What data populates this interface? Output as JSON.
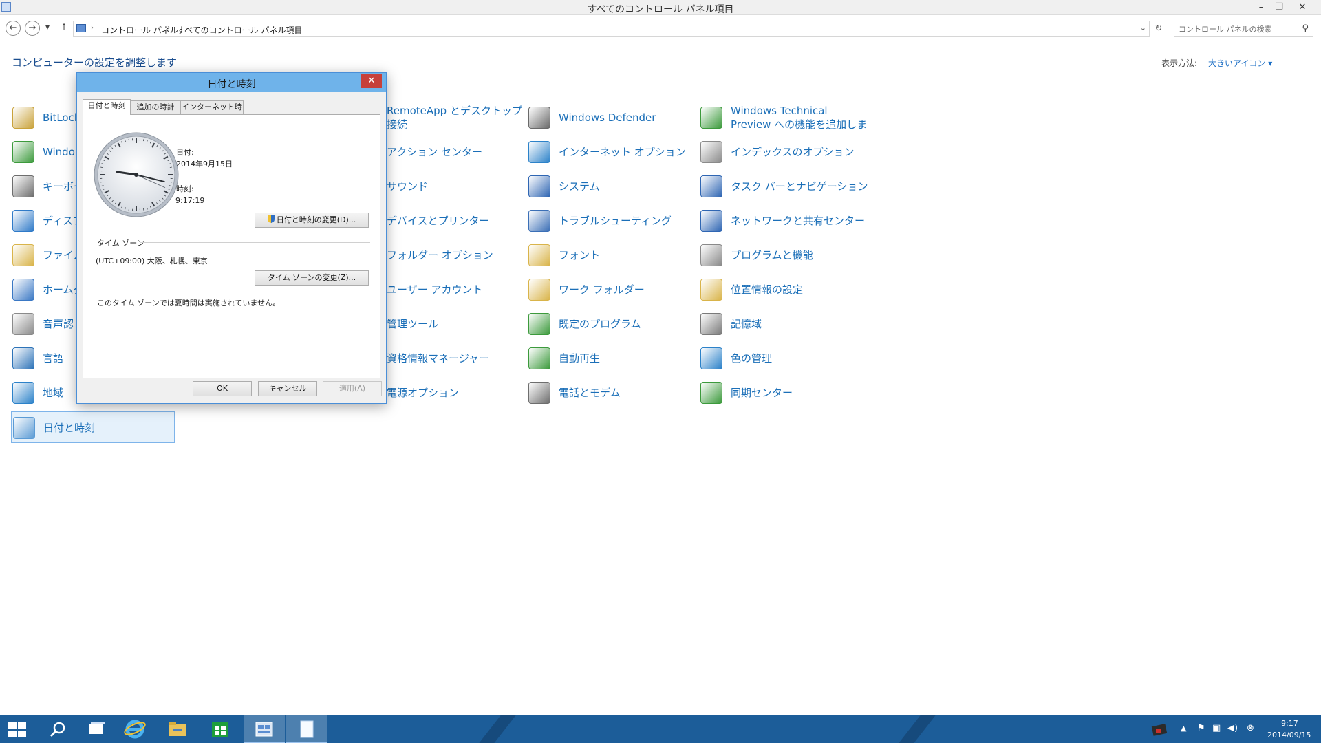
{
  "window": {
    "title": "すべてのコントロール パネル項目",
    "minimize": "–",
    "restore": "❐",
    "close": "✕"
  },
  "addressbar": {
    "back": "←",
    "forward": "→",
    "recent": "▾",
    "up": "↑",
    "breadcrumbs": [
      "コントロール パネル",
      "すべてのコントロール パネル項目"
    ],
    "breadcrumb_sep": "›",
    "dropdown": "⌄",
    "refresh": "↻",
    "search_placeholder": "コントロール パネルの検索",
    "search_glyph": "⚲"
  },
  "header": {
    "heading": "コンピューターの設定を調整します",
    "view_label": "表示方法:",
    "view_value": "大きいアイコン ▾"
  },
  "items": {
    "col1": [
      {
        "label": "BitLock",
        "icon": "bitlocker-icon",
        "color": "#c9a23a"
      },
      {
        "label": "Windo",
        "icon": "windows-update-icon",
        "color": "#3c9a3c"
      },
      {
        "label": "キーボー",
        "icon": "keyboard-icon",
        "color": "#6e6e6e"
      },
      {
        "label": "ディスプ",
        "icon": "display-icon",
        "color": "#2f7ac8"
      },
      {
        "label": "ファイル",
        "icon": "file-history-icon",
        "color": "#d9b44a"
      },
      {
        "label": "ホームグ",
        "icon": "homegroup-icon",
        "color": "#3a78c4"
      },
      {
        "label": "音声認",
        "icon": "microphone-icon",
        "color": "#8a8a8a"
      },
      {
        "label": "言語",
        "icon": "language-icon",
        "color": "#2d73b8"
      },
      {
        "label": "地域",
        "icon": "region-icon",
        "color": "#2c82c9"
      },
      {
        "label": "日付と時刻",
        "icon": "date-time-icon",
        "color": "#5b9bd5"
      }
    ],
    "col2": [
      {
        "label": "RemoteApp とデスクトップ接続",
        "icon": "remoteapp-icon",
        "color": "#3a78c4"
      },
      {
        "label": "アクション センター",
        "icon": "action-center-icon",
        "color": "#3b6fb6"
      },
      {
        "label": "サウンド",
        "icon": "sound-icon",
        "color": "#8c8c8c"
      },
      {
        "label": "デバイスとプリンター",
        "icon": "printer-icon",
        "color": "#6b6b6b"
      },
      {
        "label": "フォルダー オプション",
        "icon": "folder-options-icon",
        "color": "#d9b44a"
      },
      {
        "label": "ユーザー アカウント",
        "icon": "user-accounts-icon",
        "color": "#3c8a4a"
      },
      {
        "label": "管理ツール",
        "icon": "admin-tools-icon",
        "color": "#7a7a7a"
      },
      {
        "label": "資格情報マネージャー",
        "icon": "credential-manager-icon",
        "color": "#c9a23a"
      },
      {
        "label": "電源オプション",
        "icon": "power-options-icon",
        "color": "#3c9a3c"
      }
    ],
    "col3": [
      {
        "label": "Windows Defender",
        "icon": "defender-icon",
        "color": "#6a6a6a"
      },
      {
        "label": "インターネット オプション",
        "icon": "internet-options-icon",
        "color": "#2c82c9"
      },
      {
        "label": "システム",
        "icon": "system-icon",
        "color": "#2f66b3"
      },
      {
        "label": "トラブルシューティング",
        "icon": "troubleshooting-icon",
        "color": "#3b6fb6"
      },
      {
        "label": "フォント",
        "icon": "fonts-icon",
        "color": "#d9b44a"
      },
      {
        "label": "ワーク フォルダー",
        "icon": "work-folders-icon",
        "color": "#d9b44a"
      },
      {
        "label": "既定のプログラム",
        "icon": "default-programs-icon",
        "color": "#3c9a3c"
      },
      {
        "label": "自動再生",
        "icon": "autoplay-icon",
        "color": "#3c9a3c"
      },
      {
        "label": "電話とモデム",
        "icon": "phone-modem-icon",
        "color": "#6e6e6e"
      }
    ],
    "col4": [
      {
        "label": "Windows Technical Preview への機能を追加しま",
        "icon": "add-features-icon",
        "color": "#3c9a3c"
      },
      {
        "label": "インデックスのオプション",
        "icon": "indexing-options-icon",
        "color": "#8a8a8a"
      },
      {
        "label": "タスク バーとナビゲーション",
        "icon": "taskbar-navigation-icon",
        "color": "#2f66b3"
      },
      {
        "label": "ネットワークと共有センター",
        "icon": "network-sharing-icon",
        "color": "#2f66b3"
      },
      {
        "label": "プログラムと機能",
        "icon": "programs-features-icon",
        "color": "#8a8a8a"
      },
      {
        "label": "位置情報の設定",
        "icon": "location-settings-icon",
        "color": "#d9b44a"
      },
      {
        "label": "記憶域",
        "icon": "storage-spaces-icon",
        "color": "#7a7a7a"
      },
      {
        "label": "色の管理",
        "icon": "color-management-icon",
        "color": "#2c82c9"
      },
      {
        "label": "同期センター",
        "icon": "sync-center-icon",
        "color": "#3c9a3c"
      }
    ]
  },
  "dialog": {
    "title": "日付と時刻",
    "close": "✕",
    "tabs": [
      "日付と時刻",
      "追加の時計",
      "インターネット時刻"
    ],
    "date_label": "日付:",
    "date_value": "2014年9月15日",
    "time_label": "時刻:",
    "time_value": "9:17:19",
    "change_datetime_button": "日付と時刻の変更(D)...",
    "timezone_group": "タイム ゾーン",
    "timezone_value": "(UTC+09:00) 大阪、札幌、東京",
    "change_timezone_button": "タイム ゾーンの変更(Z)...",
    "dst_note": "このタイム ゾーンでは夏時間は実施されていません。",
    "ok": "OK",
    "cancel": "キャンセル",
    "apply": "適用(A)"
  },
  "taskbar": {
    "clock_time": "9:17",
    "clock_date": "2014/09/15"
  }
}
